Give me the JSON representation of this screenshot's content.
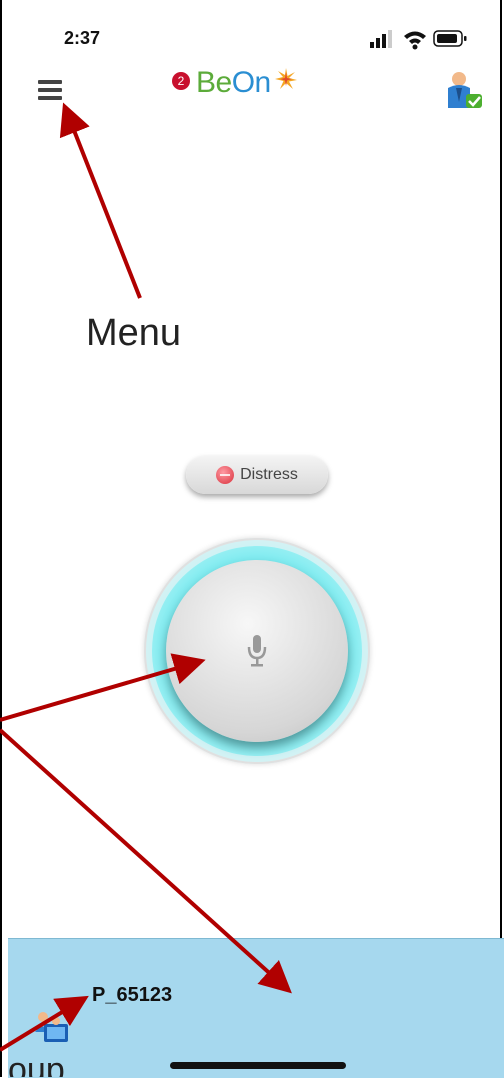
{
  "status_bar": {
    "time": "2:37"
  },
  "header": {
    "notification_count": "2",
    "logo_text_be": "Be",
    "logo_text_on": "On",
    "icons": [
      "menu-icon",
      "user-status-icon"
    ]
  },
  "annotations": {
    "menu_label": "Menu",
    "partial_label": "oup"
  },
  "main": {
    "distress_label": "Distress",
    "ptt_icon": "microphone-icon"
  },
  "bottom_panel": {
    "group_name": "P_65123",
    "group_icon": "group-users-icon"
  },
  "colors": {
    "accent_cyan": "#6ee8ee",
    "panel_blue": "#a6d8ee",
    "arrow_red": "#b00000",
    "logo_green": "#5cab3a",
    "logo_blue": "#2a8ed2"
  }
}
